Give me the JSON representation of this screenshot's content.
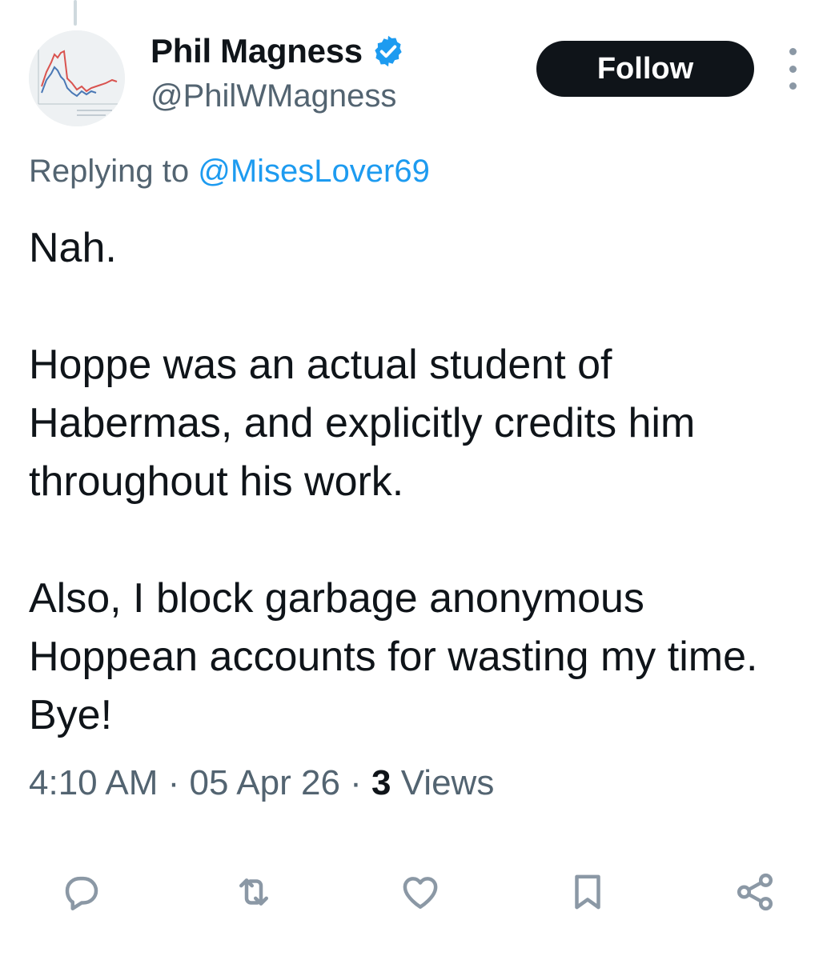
{
  "author": {
    "display_name": "Phil Magness",
    "handle": "@PhilWMagness",
    "verified": true
  },
  "follow_label": "Follow",
  "reply_context": {
    "prefix": "Replying to ",
    "mention": "@MisesLover69"
  },
  "tweet": {
    "paragraphs": [
      "Nah.",
      "Hoppe was an actual student of Habermas, and explicitly credits him throughout his work.",
      "Also, I block garbage anonymous Hoppean accounts for wasting my time. Bye!"
    ]
  },
  "meta": {
    "time": "4:10 AM",
    "separator": " · ",
    "date": "05 Apr 26",
    "views_count": "3",
    "views_label": " Views"
  },
  "actions": [
    {
      "name": "reply",
      "icon": "reply-icon"
    },
    {
      "name": "retweet",
      "icon": "retweet-icon"
    },
    {
      "name": "like",
      "icon": "heart-icon"
    },
    {
      "name": "bookmark",
      "icon": "bookmark-icon"
    },
    {
      "name": "share",
      "icon": "share-icon"
    }
  ],
  "colors": {
    "text": "#0f1419",
    "secondary": "#536471",
    "link": "#1d9bf0",
    "icon": "#8b98a5",
    "follow_bg": "#0f1419"
  }
}
